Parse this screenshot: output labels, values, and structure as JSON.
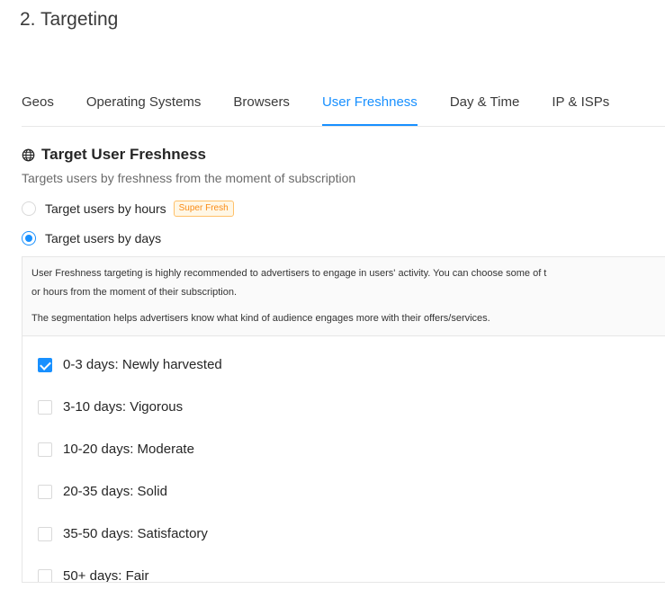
{
  "page": {
    "title": "2. Targeting"
  },
  "tabs": [
    {
      "label": "Geos"
    },
    {
      "label": "Operating Systems"
    },
    {
      "label": "Browsers"
    },
    {
      "label": "User Freshness"
    },
    {
      "label": "Day & Time"
    },
    {
      "label": "IP & ISPs"
    }
  ],
  "active_tab": "User Freshness",
  "section": {
    "title": "Target User Freshness",
    "icon": "globe-icon",
    "description": "Targets users by freshness from the moment of subscription"
  },
  "radios": [
    {
      "label": "Target users by hours",
      "badge": "Super Fresh",
      "checked": false
    },
    {
      "label": "Target users by days",
      "checked": true
    }
  ],
  "info": {
    "line1": "User Freshness targeting is highly recommended to advertisers to engage in users' activity. You can choose some of t",
    "line2": "or hours from the moment of their subscription.",
    "line3": "The segmentation helps advertisers know what kind of audience engages more with their offers/services."
  },
  "options": [
    {
      "label": "0-3 days: Newly harvested",
      "checked": true
    },
    {
      "label": "3-10 days: Vigorous",
      "checked": false
    },
    {
      "label": "10-20 days: Moderate",
      "checked": false
    },
    {
      "label": "20-35 days: Solid",
      "checked": false
    },
    {
      "label": "35-50 days: Satisfactory",
      "checked": false
    },
    {
      "label": "50+ days: Fair",
      "checked": false
    }
  ],
  "colors": {
    "accent": "#1890ff",
    "badge": "#fa8c16"
  }
}
